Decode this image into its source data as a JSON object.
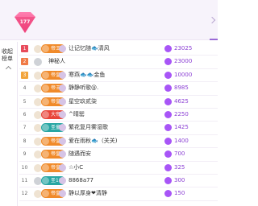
{
  "header": {
    "gem_count": "177"
  },
  "sidebar": {
    "collapse_label": "收起榜单"
  },
  "rows": [
    {
      "rank": "1",
      "badge": "帝王",
      "badge_color": "#f08a2a",
      "name": "让记忆随🐟清风",
      "value": "23025"
    },
    {
      "rank": "2",
      "badge": "",
      "badge_color": "",
      "name": "神秘人",
      "value": "23000"
    },
    {
      "rank": "3",
      "badge": "帝皇",
      "badge_color": "#f08a2a",
      "name": "寒燕🐟🐟金鱼",
      "value": "10000"
    },
    {
      "rank": "4",
      "badge": "帝王",
      "badge_color": "#f08a2a",
      "name": "静静听歌@.",
      "value": "8985"
    },
    {
      "rank": "5",
      "badge": "帝皇",
      "badge_color": "#f08a2a",
      "name": "星空玖贰柒",
      "value": "4625"
    },
    {
      "rank": "6",
      "badge": "大帝",
      "badge_color": "#e8463a",
      "name": "^晴罂",
      "value": "2250"
    },
    {
      "rank": "7",
      "badge": "圣童",
      "badge_color": "#27a6a3",
      "name": "繁花复月雾湿歌",
      "value": "1425"
    },
    {
      "rank": "8",
      "badge": "帝皇",
      "badge_color": "#f08a2a",
      "name": "爱在雨秋🐟（关关)",
      "value": "1400"
    },
    {
      "rank": "9",
      "badge": "帝皇",
      "badge_color": "#f08a2a",
      "name": "随遇而安",
      "value": "700"
    },
    {
      "rank": "10",
      "badge": "帝皇",
      "badge_color": "#f08a2a",
      "name": "☆小C",
      "value": "325"
    },
    {
      "rank": "11",
      "badge": "圣11",
      "badge_color": "#27a6a3",
      "name": "8868a77",
      "value": "300"
    },
    {
      "rank": "12",
      "badge": "帝皇",
      "badge_color": "#f08a2a",
      "name": "静以厚身❤清静",
      "value": "150"
    }
  ]
}
